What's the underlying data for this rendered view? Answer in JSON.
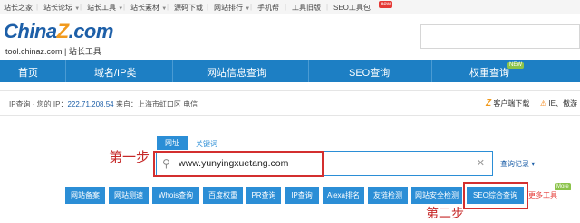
{
  "topbar": {
    "items": [
      "站长之家",
      "站长论坛",
      "站长工具",
      "站长素材",
      "源码下载",
      "网站排行",
      "手机帮",
      "工具旧版",
      "SEO工具包"
    ],
    "new_badge": "new"
  },
  "logo": {
    "name_part1": "China",
    "name_z": "Z",
    "name_part2": ".com",
    "subtitle": "tool.chinaz.com | 站长工具"
  },
  "nav": {
    "items": [
      "首页",
      "域名/IP类",
      "网站信息查询",
      "SEO查询",
      "权重查询"
    ],
    "new_badge": "NEW"
  },
  "infobar": {
    "ip_prefix": "IP查询 · 您的 IP：",
    "ip": "222.71.208.54",
    "from": " 来自：上海市虹口区 电信",
    "client_download": "客户端下载",
    "ie_note": "IE、傲游"
  },
  "search": {
    "tab_site": "网址",
    "tab_keyword": "关键词",
    "value": "www.yunyingxuetang.com",
    "history": "查询记录 ▾"
  },
  "buttons": [
    "网站备案",
    "网站测速",
    "Whois查询",
    "百度权重",
    "PR查询",
    "IP查询",
    "Alexa排名",
    "友链检测",
    "网站安全检测",
    "SEO综合查询"
  ],
  "more": {
    "label": "更多工具",
    "badge": "More"
  },
  "annotations": {
    "step1": "第一步",
    "step2": "第二步"
  },
  "colors": {
    "nav_blue": "#1d7fc4",
    "button_blue": "#2b8ed6",
    "annotation_red": "#d32f2f",
    "logo_orange": "#f19a1d"
  }
}
